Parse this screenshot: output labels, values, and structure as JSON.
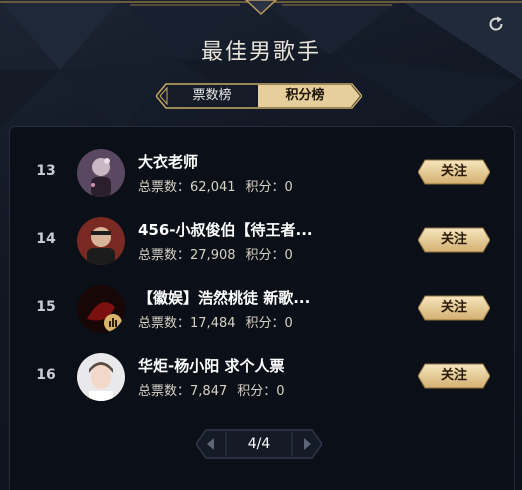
{
  "header": {
    "title": "最佳男歌手",
    "refresh_icon": "refresh-icon"
  },
  "tabs": [
    {
      "label": "票数榜",
      "active": false
    },
    {
      "label": "积分榜",
      "active": true
    }
  ],
  "entries": [
    {
      "rank": "13",
      "name": "大衣老师",
      "votes_label": "总票数：",
      "votes": "62,041",
      "points_label": "积分：",
      "points": "0",
      "button": "关注"
    },
    {
      "rank": "14",
      "name": "456-小叔俊伯【待王者...",
      "votes_label": "总票数：",
      "votes": "27,908",
      "points_label": "积分：",
      "points": "0",
      "button": "关注"
    },
    {
      "rank": "15",
      "name": "【徽娱】浩然桃徒 新歌...",
      "votes_label": "总票数：",
      "votes": "17,484",
      "points_label": "积分：",
      "points": "0",
      "button": "关注"
    },
    {
      "rank": "16",
      "name": "华炬-杨小阳 求个人票",
      "votes_label": "总票数：",
      "votes": "7,847",
      "points_label": "积分：",
      "points": "0",
      "button": "关注"
    }
  ],
  "pagination": {
    "text": "4/4",
    "prev_icon": "chevron-left-icon",
    "next_icon": "chevron-right-icon"
  },
  "colors": {
    "gold": "#d9b878",
    "gold_light": "#f5e3b8",
    "background": "#0d1118"
  }
}
